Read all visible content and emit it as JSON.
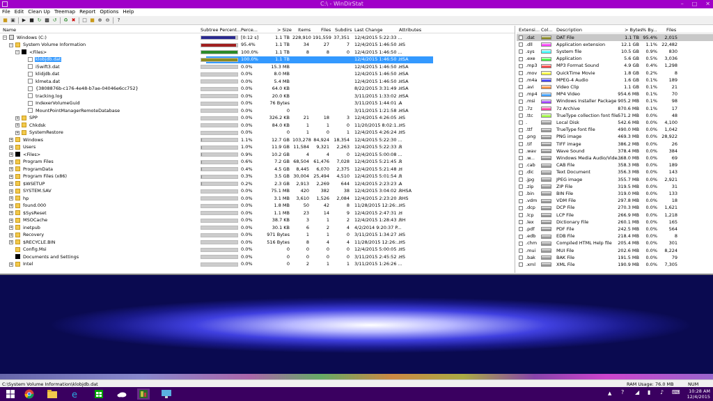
{
  "window": {
    "title": "C:\\ - WinDirStat"
  },
  "menu": [
    "File",
    "Edit",
    "Clean Up",
    "Treemap",
    "Report",
    "Options",
    "Help"
  ],
  "toolbar_icons": [
    "open-icon",
    "save-icon",
    "play-icon",
    "stop-icon",
    "refresh-icon",
    "cmd-icon",
    "refresh-all-icon",
    "recycle-icon",
    "delete-icon",
    "select-icon",
    "folder-icon",
    "zoom-in-icon",
    "zoom-out-icon",
    "help-icon"
  ],
  "tree": {
    "columns": [
      "Name",
      "Subtree Percent...",
      "Perce...",
      "> Size",
      "Items",
      "Files",
      "Subdirs",
      "Last Change",
      "Attributes"
    ],
    "rows": [
      {
        "name": "Windows (C:)",
        "depth": 0,
        "icon": "drive",
        "exp": "-",
        "bar": 0.95,
        "barColor": "#2a2a90",
        "perc": "[0:12 s]",
        "size": "1.1 TB",
        "items": "228,910",
        "files": "191,559",
        "subdirs": "37,351",
        "date": "12/4/2015 5:22:33 ...",
        "attr": ""
      },
      {
        "name": "System Volume Information",
        "depth": 1,
        "icon": "folder",
        "exp": "-",
        "bar": 0.954,
        "barColor": "#a02020",
        "perc": "95.4%",
        "size": "1.1 TB",
        "items": "34",
        "files": "27",
        "subdirs": "7",
        "date": "12/4/2015 1:46:50 ...",
        "attr": "HS"
      },
      {
        "name": "<Files>",
        "depth": 2,
        "icon": "black",
        "exp": "-",
        "bar": 1.0,
        "barColor": "#2a8a2a",
        "perc": "100.0%",
        "size": "1.1 TB",
        "items": "8",
        "files": "8",
        "subdirs": "0",
        "date": "12/4/2015 1:46:50 ...",
        "attr": ""
      },
      {
        "name": "klobjdb.dat",
        "depth": 3,
        "icon": "file",
        "exp": "",
        "bar": 1.0,
        "barColor": "#8a8a20",
        "perc": "100.0%",
        "size": "1.1 TB",
        "items": "",
        "files": "",
        "subdirs": "",
        "date": "12/4/2015 1:46:50 ...",
        "attr": "HSA",
        "sel": true
      },
      {
        "name": "i5wift3.dat",
        "depth": 3,
        "icon": "file",
        "exp": "",
        "bar": 0,
        "barColor": "#888",
        "perc": "0.0%",
        "size": "15.3 MB",
        "items": "",
        "files": "",
        "subdirs": "",
        "date": "12/4/2015 1:46:50 ...",
        "attr": "HSA"
      },
      {
        "name": "klidjdb.dat",
        "depth": 3,
        "icon": "file",
        "exp": "",
        "bar": 0,
        "barColor": "#888",
        "perc": "0.0%",
        "size": "8.0 MB",
        "items": "",
        "files": "",
        "subdirs": "",
        "date": "12/4/2015 1:46:50 ...",
        "attr": "HSA"
      },
      {
        "name": "klmeta.dat",
        "depth": 3,
        "icon": "file",
        "exp": "",
        "bar": 0,
        "barColor": "#888",
        "perc": "0.0%",
        "size": "5.4 MB",
        "items": "",
        "files": "",
        "subdirs": "",
        "date": "12/4/2015 1:46:50 ...",
        "attr": "HSA"
      },
      {
        "name": "{3808876b-c176-4e48-b7ae-04046e6cc752}",
        "depth": 3,
        "icon": "file",
        "exp": "",
        "bar": 0,
        "barColor": "#888",
        "perc": "0.0%",
        "size": "64.0 KB",
        "items": "",
        "files": "",
        "subdirs": "",
        "date": "8/22/2015 3:31:49 ...",
        "attr": "HSA"
      },
      {
        "name": "tracking.log",
        "depth": 3,
        "icon": "file",
        "exp": "",
        "bar": 0,
        "barColor": "#888",
        "perc": "0.0%",
        "size": "20.0 KB",
        "items": "",
        "files": "",
        "subdirs": "",
        "date": "3/11/2015 1:33:02 ...",
        "attr": "HSA"
      },
      {
        "name": "IndexerVolumeGuid",
        "depth": 3,
        "icon": "file",
        "exp": "",
        "bar": 0,
        "barColor": "#888",
        "perc": "0.0%",
        "size": "76 Bytes",
        "items": "",
        "files": "",
        "subdirs": "",
        "date": "3/11/2015 1:44:01 ...",
        "attr": "A"
      },
      {
        "name": "MountPointManagerRemoteDatabase",
        "depth": 3,
        "icon": "file",
        "exp": "",
        "bar": 0,
        "barColor": "#888",
        "perc": "0.0%",
        "size": "0",
        "items": "",
        "files": "",
        "subdirs": "",
        "date": "3/11/2015 1:21:58 ...",
        "attr": "HSA"
      },
      {
        "name": "SPP",
        "depth": 2,
        "icon": "folder",
        "exp": "+",
        "bar": 0,
        "barColor": "#888",
        "perc": "0.0%",
        "size": "326.2 KB",
        "items": "21",
        "files": "18",
        "subdirs": "3",
        "date": "12/4/2015 4:26:05 ...",
        "attr": "HS"
      },
      {
        "name": "Chkdsk",
        "depth": 2,
        "icon": "folder",
        "exp": "+",
        "bar": 0,
        "barColor": "#888",
        "perc": "0.0%",
        "size": "84.0 KB",
        "items": "1",
        "files": "1",
        "subdirs": "0",
        "date": "11/20/2015 8:02:1...",
        "attr": "HS"
      },
      {
        "name": "SystemRestore",
        "depth": 2,
        "icon": "folder",
        "exp": "+",
        "bar": 0,
        "barColor": "#888",
        "perc": "0.0%",
        "size": "0",
        "items": "1",
        "files": "0",
        "subdirs": "1",
        "date": "12/4/2015 4:26:24 ...",
        "attr": "HS"
      },
      {
        "name": "Windows",
        "depth": 1,
        "icon": "folder",
        "exp": "+",
        "bar": 0.011,
        "barColor": "#888",
        "perc": "1.1%",
        "size": "12.7 GB",
        "items": "103,278",
        "files": "84,924",
        "subdirs": "18,354",
        "date": "12/4/2015 5:22:30 ...",
        "attr": ""
      },
      {
        "name": "Users",
        "depth": 1,
        "icon": "folder",
        "exp": "+",
        "bar": 0.01,
        "barColor": "#888",
        "perc": "1.0%",
        "size": "11.9 GB",
        "items": "11,584",
        "files": "9,321",
        "subdirs": "2,263",
        "date": "12/4/2015 5:22:33 ...",
        "attr": "R"
      },
      {
        "name": "<Files>",
        "depth": 1,
        "icon": "black",
        "exp": "+",
        "bar": 0.009,
        "barColor": "#888",
        "perc": "0.9%",
        "size": "10.2 GB",
        "items": "4",
        "files": "4",
        "subdirs": "0",
        "date": "12/4/2015 5:00:08 ...",
        "attr": ""
      },
      {
        "name": "Program Files",
        "depth": 1,
        "icon": "folder",
        "exp": "+",
        "bar": 0.006,
        "barColor": "#888",
        "perc": "0.6%",
        "size": "7.2 GB",
        "items": "68,504",
        "files": "61,476",
        "subdirs": "7,028",
        "date": "12/4/2015 5:21:45 ...",
        "attr": "R"
      },
      {
        "name": "ProgramData",
        "depth": 1,
        "icon": "folder",
        "exp": "+",
        "bar": 0.004,
        "barColor": "#888",
        "perc": "0.4%",
        "size": "4.5 GB",
        "items": "8,445",
        "files": "6,070",
        "subdirs": "2,375",
        "date": "12/4/2015 5:21:48 ...",
        "attr": "H"
      },
      {
        "name": "Program Files (x86)",
        "depth": 1,
        "icon": "folder",
        "exp": "+",
        "bar": 0.003,
        "barColor": "#888",
        "perc": "0.3%",
        "size": "3.5 GB",
        "items": "30,004",
        "files": "25,494",
        "subdirs": "4,510",
        "date": "12/4/2015 5:01:54 ...",
        "attr": "R"
      },
      {
        "name": "$WSETUP",
        "depth": 1,
        "icon": "folder",
        "exp": "+",
        "bar": 0.002,
        "barColor": "#888",
        "perc": "0.2%",
        "size": "2.3 GB",
        "items": "2,913",
        "files": "2,269",
        "subdirs": "644",
        "date": "12/4/2015 2:23:23 ...",
        "attr": "A"
      },
      {
        "name": "SYSTEM.SAV",
        "depth": 1,
        "icon": "folder",
        "exp": "+",
        "bar": 0,
        "barColor": "#888",
        "perc": "0.0%",
        "size": "75.1 MB",
        "items": "420",
        "files": "382",
        "subdirs": "38",
        "date": "12/4/2015 3:04:02 ...",
        "attr": "RHSA"
      },
      {
        "name": "hp",
        "depth": 1,
        "icon": "folder",
        "exp": "+",
        "bar": 0,
        "barColor": "#888",
        "perc": "0.0%",
        "size": "3.1 MB",
        "items": "3,610",
        "files": "1,526",
        "subdirs": "2,084",
        "date": "12/4/2015 2:23:20 ...",
        "attr": "RHS"
      },
      {
        "name": "found.000",
        "depth": 1,
        "icon": "folder",
        "exp": "+",
        "bar": 0,
        "barColor": "#888",
        "perc": "0.0%",
        "size": "1.8 MB",
        "items": "50",
        "files": "42",
        "subdirs": "8",
        "date": "11/28/2015 12:26:...",
        "attr": "HS"
      },
      {
        "name": "$SysReset",
        "depth": 1,
        "icon": "folder",
        "exp": "+",
        "bar": 0,
        "barColor": "#888",
        "perc": "0.0%",
        "size": "1.1 MB",
        "items": "23",
        "files": "14",
        "subdirs": "9",
        "date": "12/4/2015 2:47:31 ...",
        "attr": "H"
      },
      {
        "name": "MSOCache",
        "depth": 1,
        "icon": "folder",
        "exp": "+",
        "bar": 0,
        "barColor": "#888",
        "perc": "0.0%",
        "size": "38.7 KB",
        "items": "3",
        "files": "1",
        "subdirs": "2",
        "date": "12/4/2015 1:28:43 ...",
        "attr": "RH"
      },
      {
        "name": "inetpub",
        "depth": 1,
        "icon": "folder",
        "exp": "+",
        "bar": 0,
        "barColor": "#888",
        "perc": "0.0%",
        "size": "30.1 KB",
        "items": "6",
        "files": "2",
        "subdirs": "4",
        "date": "4/2/2014 9:20:37 P...",
        "attr": ""
      },
      {
        "name": "Recovery",
        "depth": 1,
        "icon": "folder",
        "exp": "+",
        "bar": 0,
        "barColor": "#888",
        "perc": "0.0%",
        "size": "971 Bytes",
        "items": "1",
        "files": "1",
        "subdirs": "0",
        "date": "3/11/2015 1:34:27 ...",
        "attr": "HS"
      },
      {
        "name": "$RECYCLE.BIN",
        "depth": 1,
        "icon": "folder",
        "exp": "+",
        "bar": 0,
        "barColor": "#888",
        "perc": "0.0%",
        "size": "516 Bytes",
        "items": "8",
        "files": "4",
        "subdirs": "4",
        "date": "11/28/2015 12:26:...",
        "attr": "HS"
      },
      {
        "name": "Config.Msi",
        "depth": 1,
        "icon": "folder",
        "exp": "",
        "bar": 0,
        "barColor": "#888",
        "perc": "0.0%",
        "size": "0",
        "items": "0",
        "files": "0",
        "subdirs": "0",
        "date": "12/4/2015 5:00:05 ...",
        "attr": "HS"
      },
      {
        "name": "Documents and Settings",
        "depth": 1,
        "icon": "black",
        "exp": "",
        "bar": 0,
        "barColor": "#888",
        "perc": "0.0%",
        "size": "0",
        "items": "0",
        "files": "0",
        "subdirs": "0",
        "date": "3/11/2015 2:45:52 ...",
        "attr": "HS"
      },
      {
        "name": "Intel",
        "depth": 1,
        "icon": "folder",
        "exp": "+",
        "bar": 0,
        "barColor": "#888",
        "perc": "0.0%",
        "size": "0",
        "items": "2",
        "files": "1",
        "subdirs": "1",
        "date": "3/11/2015 1:26:26 ...",
        "attr": ""
      }
    ]
  },
  "extensions": {
    "columns": [
      "Extensi...",
      "Col...",
      "Description",
      "> Bytes",
      "% By...",
      "Files"
    ],
    "rows": [
      {
        "ext": ".dat",
        "color": "#8a8a20",
        "desc": "DAT File",
        "bytes": "1.1 TB",
        "pct": "95.4%",
        "files": "2,015",
        "sel": true
      },
      {
        "ext": ".dll",
        "color": "#ff40ff",
        "desc": "Application extension",
        "bytes": "12.1 GB",
        "pct": "1.1%",
        "files": "22,482"
      },
      {
        "ext": ".sys",
        "color": "#40ffff",
        "desc": "System file",
        "bytes": "10.5 GB",
        "pct": "0.9%",
        "files": "830"
      },
      {
        "ext": ".exe",
        "color": "#40ff40",
        "desc": "Application",
        "bytes": "5.6 GB",
        "pct": "0.5%",
        "files": "3,036"
      },
      {
        "ext": ".mp3",
        "color": "#ff4040",
        "desc": "MP3 Format Sound",
        "bytes": "4.9 GB",
        "pct": "0.4%",
        "files": "1,298"
      },
      {
        "ext": ".mov",
        "color": "#ffff40",
        "desc": "QuickTime Movie",
        "bytes": "1.8 GB",
        "pct": "0.2%",
        "files": "8"
      },
      {
        "ext": ".m4a",
        "color": "#4040ff",
        "desc": "MPEG-4 Audio",
        "bytes": "1.6 GB",
        "pct": "0.1%",
        "files": "189"
      },
      {
        "ext": ".avi",
        "color": "#ff9040",
        "desc": "Video Clip",
        "bytes": "1.1 GB",
        "pct": "0.1%",
        "files": "21"
      },
      {
        "ext": ".mp4",
        "color": "#40a0ff",
        "desc": "MP4 Video",
        "bytes": "954.6 MB",
        "pct": "0.1%",
        "files": "70"
      },
      {
        "ext": ".msi",
        "color": "#a040ff",
        "desc": "Windows Installer Package",
        "bytes": "905.2 MB",
        "pct": "0.1%",
        "files": "98"
      },
      {
        "ext": ".7z",
        "color": "#ff40a0",
        "desc": "7z Archive",
        "bytes": "870.6 MB",
        "pct": "0.1%",
        "files": "17"
      },
      {
        "ext": ".ttc",
        "color": "#a0ff40",
        "desc": "TrueType collection font file",
        "bytes": "571.2 MB",
        "pct": "0.0%",
        "files": "48"
      },
      {
        "ext": ".",
        "color": "#999999",
        "desc": "Local Disk",
        "bytes": "542.6 MB",
        "pct": "0.0%",
        "files": "4,100"
      },
      {
        "ext": ".ttf",
        "color": "#999999",
        "desc": "TrueType font file",
        "bytes": "490.0 MB",
        "pct": "0.0%",
        "files": "1,042"
      },
      {
        "ext": ".png",
        "color": "#999999",
        "desc": "PNG image",
        "bytes": "469.3 MB",
        "pct": "0.0%",
        "files": "28,922"
      },
      {
        "ext": ".tif",
        "color": "#999999",
        "desc": "TIFF image",
        "bytes": "386.2 MB",
        "pct": "0.0%",
        "files": "26"
      },
      {
        "ext": ".wav",
        "color": "#999999",
        "desc": "Wave Sound",
        "bytes": "378.4 MB",
        "pct": "0.0%",
        "files": "384"
      },
      {
        "ext": ".w...",
        "color": "#999999",
        "desc": "Windows Media Audio/Vide...",
        "bytes": "368.0 MB",
        "pct": "0.0%",
        "files": "69"
      },
      {
        "ext": ".cab",
        "color": "#999999",
        "desc": "CAB File",
        "bytes": "358.3 MB",
        "pct": "0.0%",
        "files": "189"
      },
      {
        "ext": ".dic",
        "color": "#999999",
        "desc": "Text Document",
        "bytes": "356.3 MB",
        "pct": "0.0%",
        "files": "143"
      },
      {
        "ext": ".jpg",
        "color": "#999999",
        "desc": "JPEG image",
        "bytes": "355.7 MB",
        "pct": "0.0%",
        "files": "2,921"
      },
      {
        "ext": ".zip",
        "color": "#999999",
        "desc": "ZIP File",
        "bytes": "319.5 MB",
        "pct": "0.0%",
        "files": "31"
      },
      {
        "ext": ".bin",
        "color": "#999999",
        "desc": "BIN File",
        "bytes": "319.0 MB",
        "pct": "0.0%",
        "files": "133"
      },
      {
        "ext": ".vdm",
        "color": "#999999",
        "desc": "VDM File",
        "bytes": "297.8 MB",
        "pct": "0.0%",
        "files": "18"
      },
      {
        "ext": ".dcp",
        "color": "#999999",
        "desc": "DCP File",
        "bytes": "270.3 MB",
        "pct": "0.0%",
        "files": "1,621"
      },
      {
        "ext": ".lcp",
        "color": "#999999",
        "desc": "LCP File",
        "bytes": "266.9 MB",
        "pct": "0.0%",
        "files": "1,218"
      },
      {
        "ext": ".lex",
        "color": "#999999",
        "desc": "Dictionary File",
        "bytes": "260.1 MB",
        "pct": "0.0%",
        "files": "165"
      },
      {
        "ext": ".pdf",
        "color": "#999999",
        "desc": "PDF File",
        "bytes": "242.5 MB",
        "pct": "0.0%",
        "files": "564"
      },
      {
        "ext": ".edb",
        "color": "#999999",
        "desc": "EDB File",
        "bytes": "218.4 MB",
        "pct": "0.0%",
        "files": "8"
      },
      {
        "ext": ".chm",
        "color": "#999999",
        "desc": "Compiled HTML Help file",
        "bytes": "205.4 MB",
        "pct": "0.0%",
        "files": "301"
      },
      {
        "ext": ".mui",
        "color": "#999999",
        "desc": "MUI File",
        "bytes": "202.6 MB",
        "pct": "0.0%",
        "files": "8,224"
      },
      {
        "ext": ".bak",
        "color": "#999999",
        "desc": "BAK File",
        "bytes": "191.5 MB",
        "pct": "0.0%",
        "files": "79"
      },
      {
        "ext": ".xml",
        "color": "#999999",
        "desc": "XML File",
        "bytes": "190.9 MB",
        "pct": "0.0%",
        "files": "7,305"
      }
    ]
  },
  "status": {
    "path": "C:\\System Volume Information\\klobjdb.dat",
    "ram_label": "RAM Usage:",
    "ram_value": "76.0 MB",
    "num": "NUM"
  },
  "taskbar": {
    "items": [
      "windows-start-icon",
      "chrome-icon",
      "file-explorer-icon",
      "ie-icon",
      "store-icon",
      "onedrive-icon",
      "windirstat-icon",
      "remote-desktop-icon"
    ],
    "time": "10:28 AM",
    "date": "12/4/2015"
  }
}
